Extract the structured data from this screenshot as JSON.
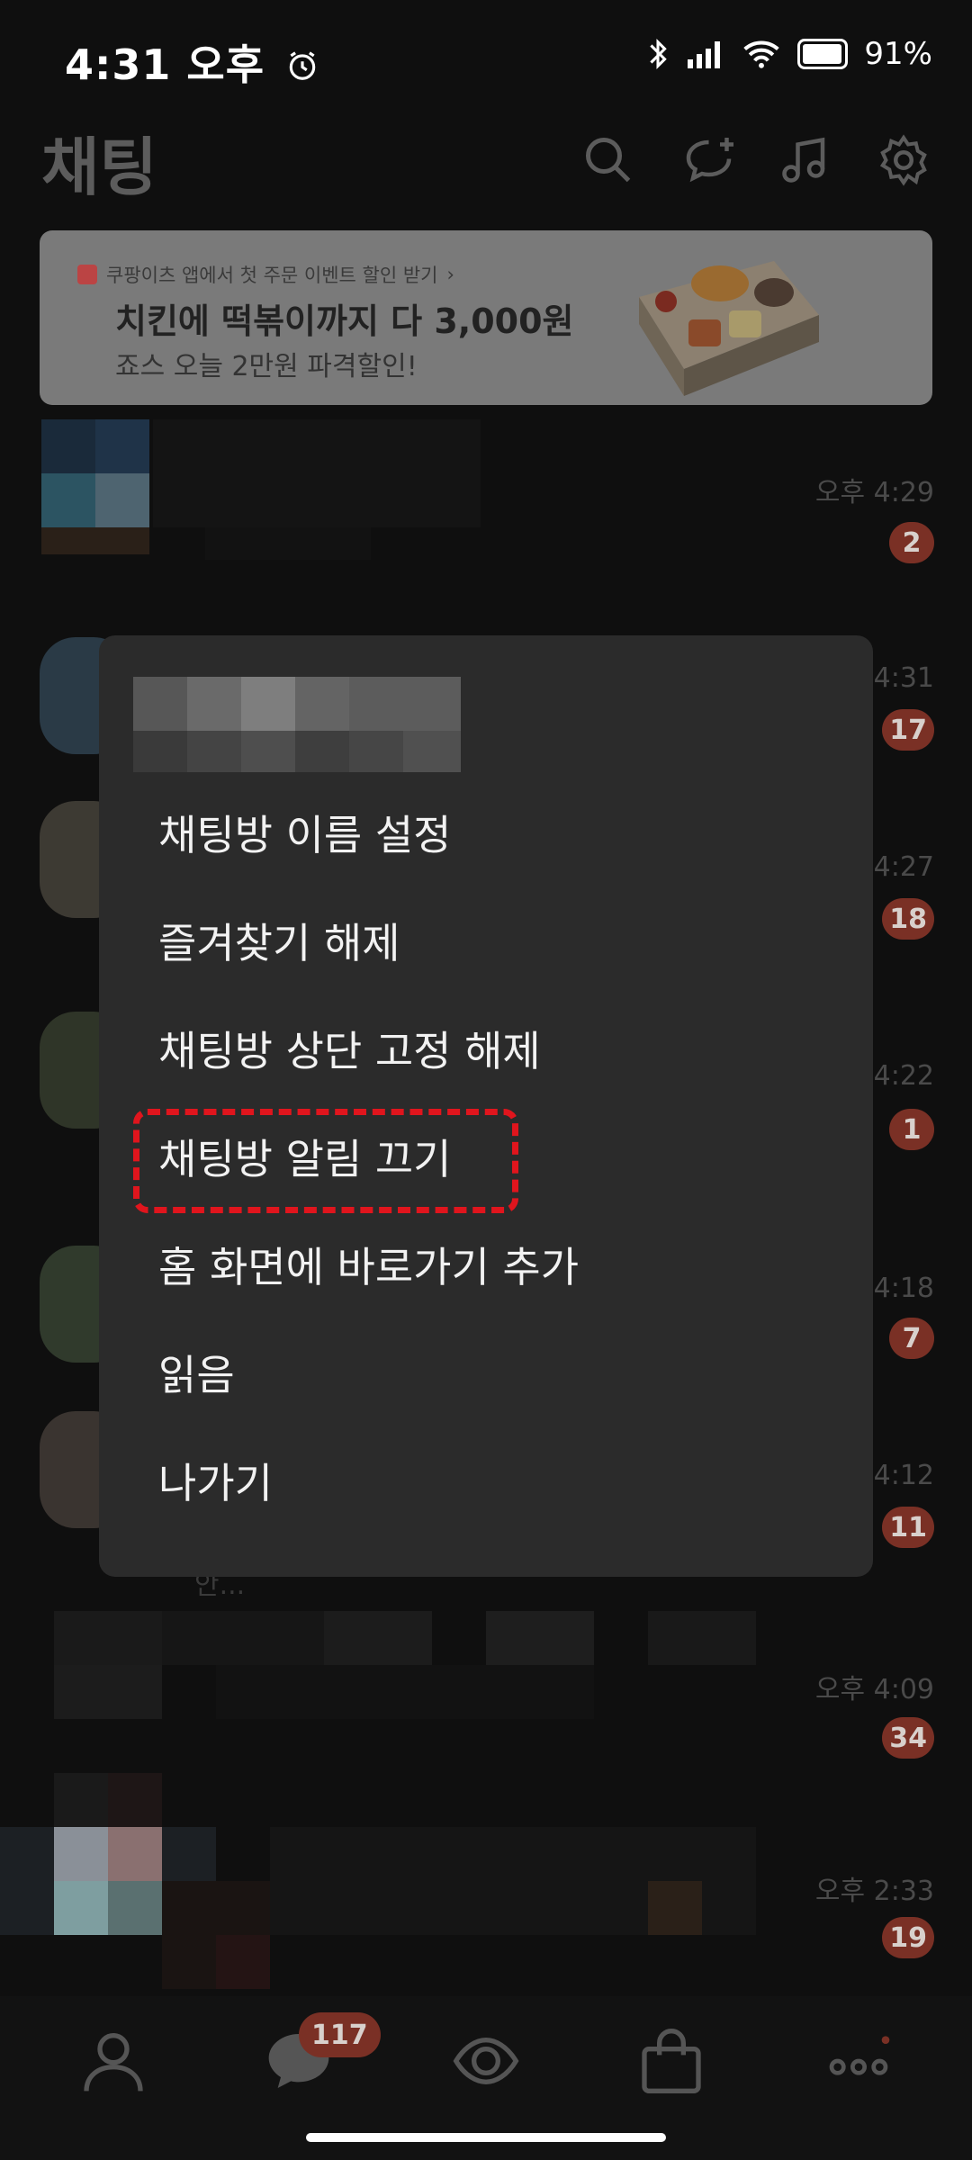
{
  "status_bar": {
    "time": "4:31 오후",
    "battery_text": "91%",
    "icons": [
      "alarm-icon",
      "bluetooth-icon",
      "signal-icon",
      "wifi-icon",
      "battery-icon"
    ]
  },
  "header": {
    "title": "채팅",
    "icons": [
      "search-icon",
      "new-chat-icon",
      "music-icon",
      "settings-icon"
    ]
  },
  "banner": {
    "sub": "쿠팡이츠 앱에서 첫 주문 이벤트 할인 받기",
    "title": "치킨에 떡볶이까지 다 3,000원",
    "desc": "죠스 오늘 2만원 파격할인!"
  },
  "chats": [
    {
      "time": "오후 4:29",
      "badge": "2"
    },
    {
      "time": "4:31",
      "badge": "17"
    },
    {
      "time": "4:27",
      "badge": "18"
    },
    {
      "time": "4:22",
      "badge": "1"
    },
    {
      "time": "4:18",
      "badge": "7"
    },
    {
      "time": "4:12",
      "badge": "11"
    },
    {
      "time": "오후 4:09",
      "badge": "34"
    },
    {
      "time": "오후 2:33",
      "badge": "19"
    }
  ],
  "snippet": "안...",
  "menu": {
    "items": [
      "채팅방 이름 설정",
      "즐겨찾기 해제",
      "채팅방 상단 고정 해제",
      "채팅방 알림 끄기",
      "홈 화면에 바로가기 추가",
      "읽음",
      "나가기"
    ],
    "highlight_color": "#e0151d"
  },
  "bottom_nav": {
    "items": [
      "friends-icon",
      "chats-icon",
      "openchat-icon",
      "shopping-icon",
      "more-icon"
    ],
    "chats_badge": "117"
  }
}
